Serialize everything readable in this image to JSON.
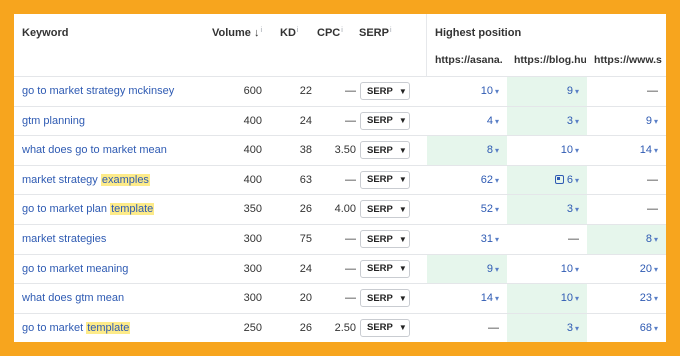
{
  "header": {
    "keyword": "Keyword",
    "volume": "Volume ↓",
    "kd": "KD",
    "cpc": "CPC",
    "serp": "SERP",
    "info": "i",
    "highest_position": "Highest position",
    "sites": [
      "https://asana.",
      "https://blog.hu",
      "https://www.s"
    ]
  },
  "serp_button": "SERP",
  "rows": [
    {
      "keyword": "go to market strategy mckinsey",
      "highlight": "",
      "volume": "600",
      "kd": "22",
      "cpc": "—",
      "pos": [
        "10",
        "9",
        "—"
      ],
      "green": [
        false,
        true,
        false
      ],
      "feature": false
    },
    {
      "keyword": "gtm planning",
      "highlight": "",
      "volume": "400",
      "kd": "24",
      "cpc": "—",
      "pos": [
        "4",
        "3",
        "9"
      ],
      "green": [
        false,
        true,
        false
      ],
      "feature": false
    },
    {
      "keyword": "what does go to market mean",
      "highlight": "",
      "volume": "400",
      "kd": "38",
      "cpc": "3.50",
      "pos": [
        "8",
        "10",
        "14"
      ],
      "green": [
        true,
        false,
        false
      ],
      "feature": false
    },
    {
      "keyword": "market strategy ",
      "highlight": "examples",
      "volume": "400",
      "kd": "63",
      "cpc": "—",
      "pos": [
        "62",
        "6",
        "—"
      ],
      "green": [
        false,
        true,
        false
      ],
      "feature": true
    },
    {
      "keyword": "go to market plan ",
      "highlight": "template",
      "volume": "350",
      "kd": "26",
      "cpc": "4.00",
      "pos": [
        "52",
        "3",
        "—"
      ],
      "green": [
        false,
        true,
        false
      ],
      "feature": false
    },
    {
      "keyword": "market strategies",
      "highlight": "",
      "volume": "300",
      "kd": "75",
      "cpc": "—",
      "pos": [
        "31",
        "—",
        "8"
      ],
      "green": [
        false,
        false,
        true
      ],
      "feature": false
    },
    {
      "keyword": "go to market meaning",
      "highlight": "",
      "volume": "300",
      "kd": "24",
      "cpc": "—",
      "pos": [
        "9",
        "10",
        "20"
      ],
      "green": [
        true,
        false,
        false
      ],
      "feature": false
    },
    {
      "keyword": "what does gtm mean",
      "highlight": "",
      "volume": "300",
      "kd": "20",
      "cpc": "—",
      "pos": [
        "14",
        "10",
        "23"
      ],
      "green": [
        false,
        true,
        false
      ],
      "feature": false
    },
    {
      "keyword": "go to market ",
      "highlight": "template",
      "volume": "250",
      "kd": "26",
      "cpc": "2.50",
      "pos": [
        "—",
        "3",
        "68"
      ],
      "green": [
        false,
        true,
        false
      ],
      "feature": false
    }
  ],
  "colors": {
    "frame": "#f7a51e",
    "link": "#2f5bb3",
    "highlight": "#fdeb8a",
    "best_position": "#e6f6ec"
  }
}
